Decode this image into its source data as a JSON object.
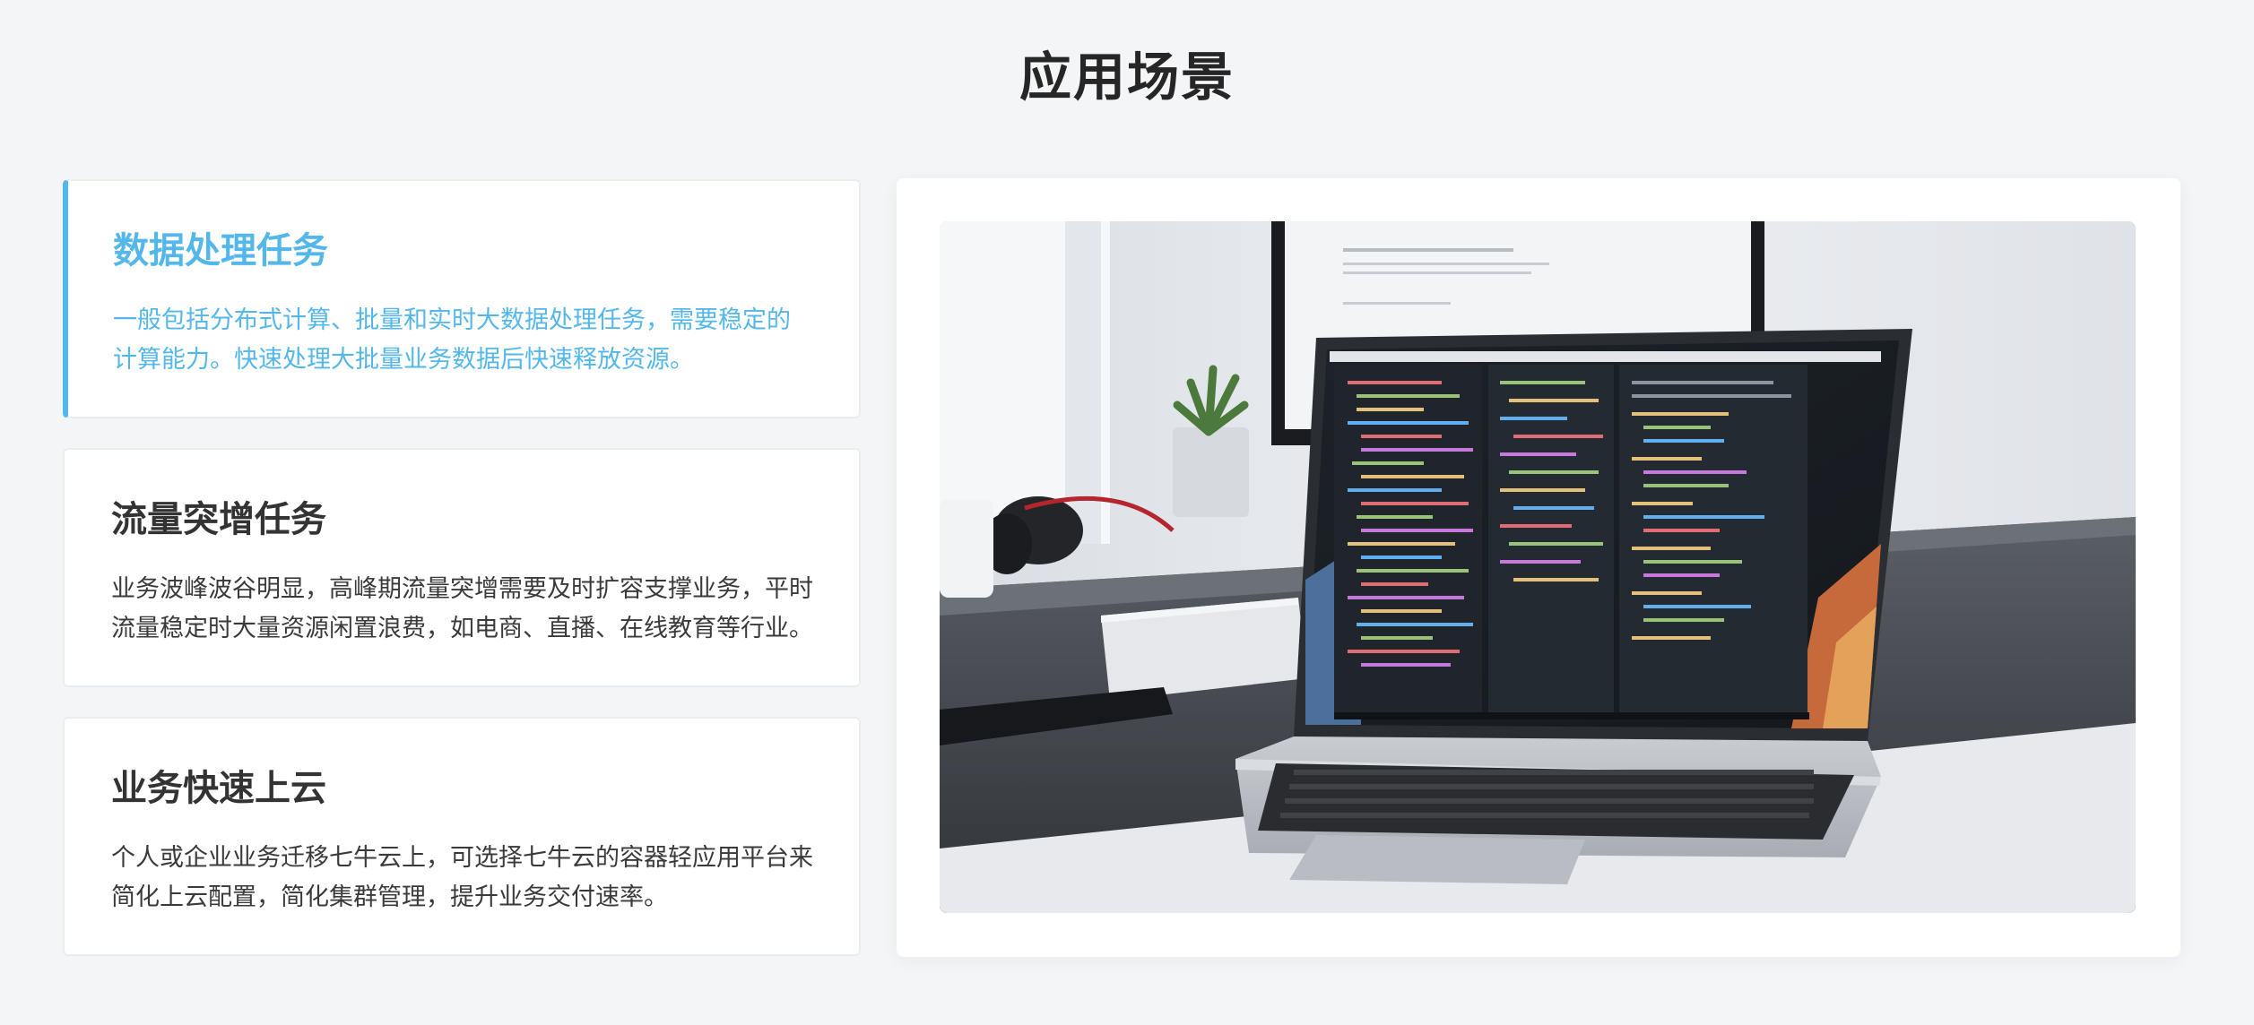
{
  "section": {
    "title": "应用场景"
  },
  "scenarios": [
    {
      "title": "数据处理任务",
      "description": "一般包括分布式计算、批量和实时大数据处理任务，需要稳定的计算能力。快速处理大批量业务数据后快速释放资源。",
      "active": true
    },
    {
      "title": "流量突增任务",
      "description": "业务波峰波谷明显，高峰期流量突增需要及时扩容支撑业务，平时流量稳定时大量资源闲置浪费，如电商、直播、在线教育等行业。",
      "active": false
    },
    {
      "title": "业务快速上云",
      "description": "个人或企业业务迁移七牛云上，可选择七牛云的容器轻应用平台来简化上云配置，简化集群管理，提升业务交付速率。",
      "active": false
    }
  ],
  "preview": {
    "image_subject": "laptop-with-code-editor-photo"
  },
  "colors": {
    "accent": "#54b7ea",
    "background": "#f4f5f7",
    "card": "#ffffff",
    "text": "#333333"
  }
}
